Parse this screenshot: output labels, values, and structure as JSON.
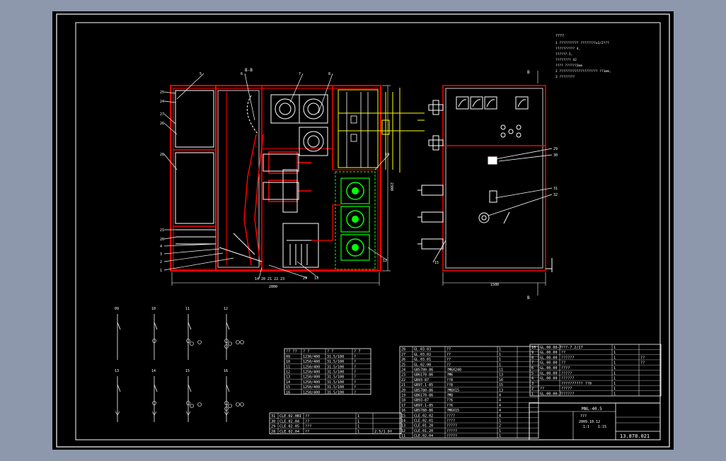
{
  "colors": {
    "viewport_bg": "#8d98ad",
    "sheet_bg": "#000000",
    "line_white": "#ffffff",
    "line_red": "#ff0000",
    "line_yellow": "#ffff00",
    "line_green": "#00ff00"
  },
  "section_label": "B-B",
  "view_marker": "B",
  "notes": {
    "title": "????",
    "lines": [
      "1  ??????????      ????????±1/2???",
      "   ?????????? 4,",
      "              ??????.5,",
      "              ???????? 42",
      "   ????     ??????2mm",
      "2  ????????????????????         ??1mm,",
      "3  ????????"
    ]
  },
  "front_callouts": [
    "5",
    "6",
    "7",
    "8",
    "10",
    "12",
    "13",
    "24",
    "25",
    "26",
    "27",
    "28",
    "21",
    "20",
    "4",
    "3",
    "2",
    "1",
    "29",
    "14 20 21 22 23"
  ],
  "side_callouts": [
    "29",
    "30",
    "31",
    "32",
    "15"
  ],
  "dims": {
    "front_width": "2000",
    "front_height": "2300",
    "side_width": "1500"
  },
  "schemes": [
    "09",
    "10",
    "11",
    "12",
    "13",
    "14",
    "15",
    "16"
  ],
  "small_table": {
    "header": [
      "?? ??",
      "? ?",
      "? ?",
      "? ?"
    ],
    "rows": [
      [
        "09",
        "1230/400",
        "31.5/100",
        "?"
      ],
      [
        "10",
        "1250/400",
        "31.5/100",
        "?"
      ],
      [
        "11",
        "1250/400",
        "31.5/100",
        "?"
      ],
      [
        "12",
        "1250/400",
        "31.5/100",
        "?"
      ],
      [
        "13",
        "1250/400",
        "31.5/100",
        "?"
      ],
      [
        "14",
        "1250/400",
        "31.5/100",
        "?"
      ],
      [
        "15",
        "1250/400",
        "31.5/100",
        "?"
      ],
      [
        "16",
        "1250/400",
        "31.5/100",
        "?"
      ]
    ]
  },
  "bom_lower": [
    [
      "31",
      "CLE.02.0BI",
      "??",
      "1",
      ""
    ],
    [
      "30",
      "CLE.02.04",
      "??",
      "1",
      ""
    ],
    [
      "29",
      "CLE.02.05",
      "???",
      "1",
      ""
    ],
    [
      "28",
      "CLE.02.04",
      "??",
      "1",
      "2.5/1.0f"
    ]
  ],
  "bom_mid": [
    [
      "28",
      "GL.03.03",
      "??",
      "1"
    ],
    [
      "27",
      "GL.03.02",
      "??",
      "1"
    ],
    [
      "26",
      "GL.03.01",
      "??",
      "1"
    ],
    [
      "25",
      "GL.02.00",
      "??",
      "1"
    ],
    [
      "24",
      "GB5780-86",
      "?M6X240",
      "11"
    ],
    [
      "23",
      "GB6170-86",
      "?M6",
      "13"
    ],
    [
      "22",
      "GB93-87",
      "??8",
      "16"
    ],
    [
      "21",
      "GB97.1-85",
      "??8",
      "15"
    ],
    [
      "20",
      "GB5780-86",
      "?M8X15",
      "13"
    ],
    [
      "19",
      "GB6170-86",
      "?M8",
      "4"
    ],
    [
      "18",
      "GB93-87",
      "??6",
      "4"
    ],
    [
      "17",
      "GB97.1-85",
      "??6",
      "4"
    ],
    [
      "16",
      "GB5780-86",
      "?M6X15",
      "4"
    ],
    [
      "15",
      "CLE.02.02",
      "????",
      "4"
    ],
    [
      "14",
      "CLE.02.01",
      "????",
      "1"
    ],
    [
      "13",
      "CLE.01.20",
      "?????",
      "2"
    ],
    [
      "12",
      "CLE.01.20",
      "?????",
      "1"
    ],
    [
      "11",
      "CLE.02.04",
      "?????",
      "1"
    ]
  ],
  "bom_right": [
    [
      "10",
      "GL.00.00-7",
      "???-7.2/27",
      "1",
      ""
    ],
    [
      "9",
      "GL.00.00",
      "??",
      "1",
      ""
    ],
    [
      "8",
      "GL.00.00",
      "??????",
      "1",
      "??"
    ],
    [
      "7",
      "GL.00.00",
      "??",
      "1",
      "??"
    ],
    [
      "6",
      "GL.00.00",
      "????",
      "1",
      ""
    ],
    [
      "5",
      "GL.00.00",
      "?????",
      "1",
      ""
    ],
    [
      "4",
      "GL.00.00",
      "??????",
      "1",
      ""
    ],
    [
      "3",
      "",
      "?????????? ??0",
      "1",
      ""
    ],
    [
      "2",
      "??",
      "?????",
      "1",
      ""
    ],
    [
      "1",
      "GL.00.00-7",
      "??????",
      "1",
      ""
    ]
  ],
  "title_block": {
    "model": "MNL-40.5",
    "name": "???",
    "date": "2009.10.12",
    "scale": "1:1",
    "sheet": "1:15",
    "drawing_no": "13.878.021"
  }
}
